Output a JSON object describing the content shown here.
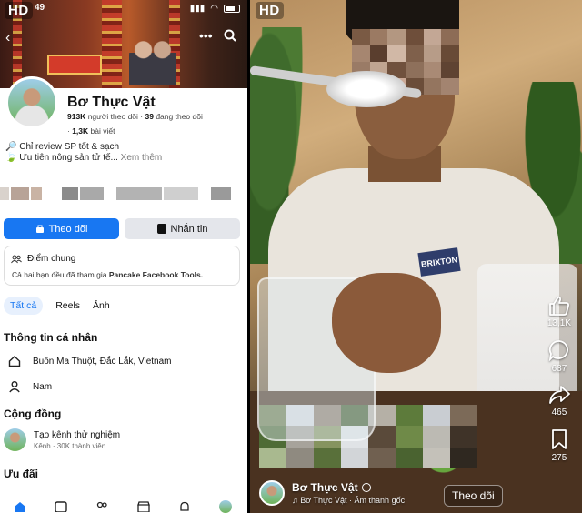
{
  "left": {
    "status": {
      "hd": "HD",
      "time": "49"
    },
    "profile": {
      "name": "Bơ Thực Vật",
      "followers_count": "913K",
      "followers_label": "người theo dõi",
      "following_count": "39",
      "following_label": "đang theo dõi",
      "posts_count": "1,3K",
      "posts_label": "bài viết"
    },
    "bio": {
      "line1": "Chỉ review SP tốt & sạch",
      "line2": "Ưu tiên nông sản tử tế...",
      "see_more": "Xem thêm"
    },
    "buttons": {
      "follow": "Theo dõi",
      "message": "Nhắn tin"
    },
    "mutual": {
      "title": "Điểm chung",
      "text_prefix": "Cả hai bạn đều đã tham gia",
      "group": "Pancake Facebook Tools."
    },
    "tabs": [
      "Tất cả",
      "Reels",
      "Ảnh"
    ],
    "personal_info": {
      "heading": "Thông tin cá nhân",
      "location": "Buôn Ma Thuột, Đắc Lắk, Vietnam",
      "gender": "Nam"
    },
    "community": {
      "heading": "Cộng đồng",
      "group_name": "Tạo kênh thử nghiệm",
      "group_meta": "Kênh · 30K thành viên"
    },
    "offers": {
      "heading": "Ưu đãi"
    }
  },
  "right": {
    "hd": "HD",
    "brand_logo": "BRIXTON",
    "actions": {
      "likes": "13,1K",
      "comments": "687",
      "shares": "465",
      "saves": "275"
    },
    "author": "Bơ Thực Vật",
    "sound": "Bơ Thực Vật · Âm thanh gốc",
    "follow": "Theo dõi"
  },
  "colors": {
    "fb_blue": "#1877f2",
    "btn_grey": "#e4e6eb"
  }
}
